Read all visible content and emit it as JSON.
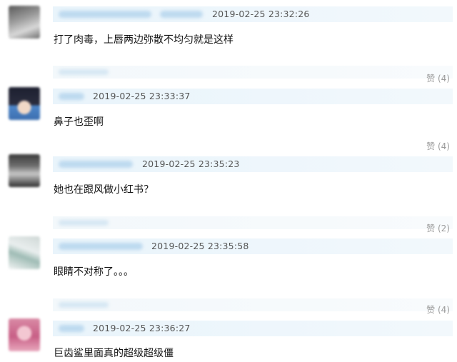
{
  "comments": [
    {
      "timestamp": "2019-02-25 23:32:26",
      "text": "打了肉毒，上唇两边弥散不均匀就是这样",
      "like_label": "赞 (4)"
    },
    {
      "timestamp": "2019-02-25 23:33:37",
      "text": "鼻子也歪啊",
      "like_label": "赞 (4)"
    },
    {
      "timestamp": "2019-02-25 23:35:23",
      "text": "她也在跟风做小红书？",
      "like_label": "赞 (2)"
    },
    {
      "timestamp": "2019-02-25 23:35:58",
      "text": "眼睛不对称了。。。",
      "like_label": "赞 (4)"
    },
    {
      "timestamp": "2019-02-25 23:36:27",
      "text": "巨齿鲨里面真的超级超级僵"
    }
  ]
}
